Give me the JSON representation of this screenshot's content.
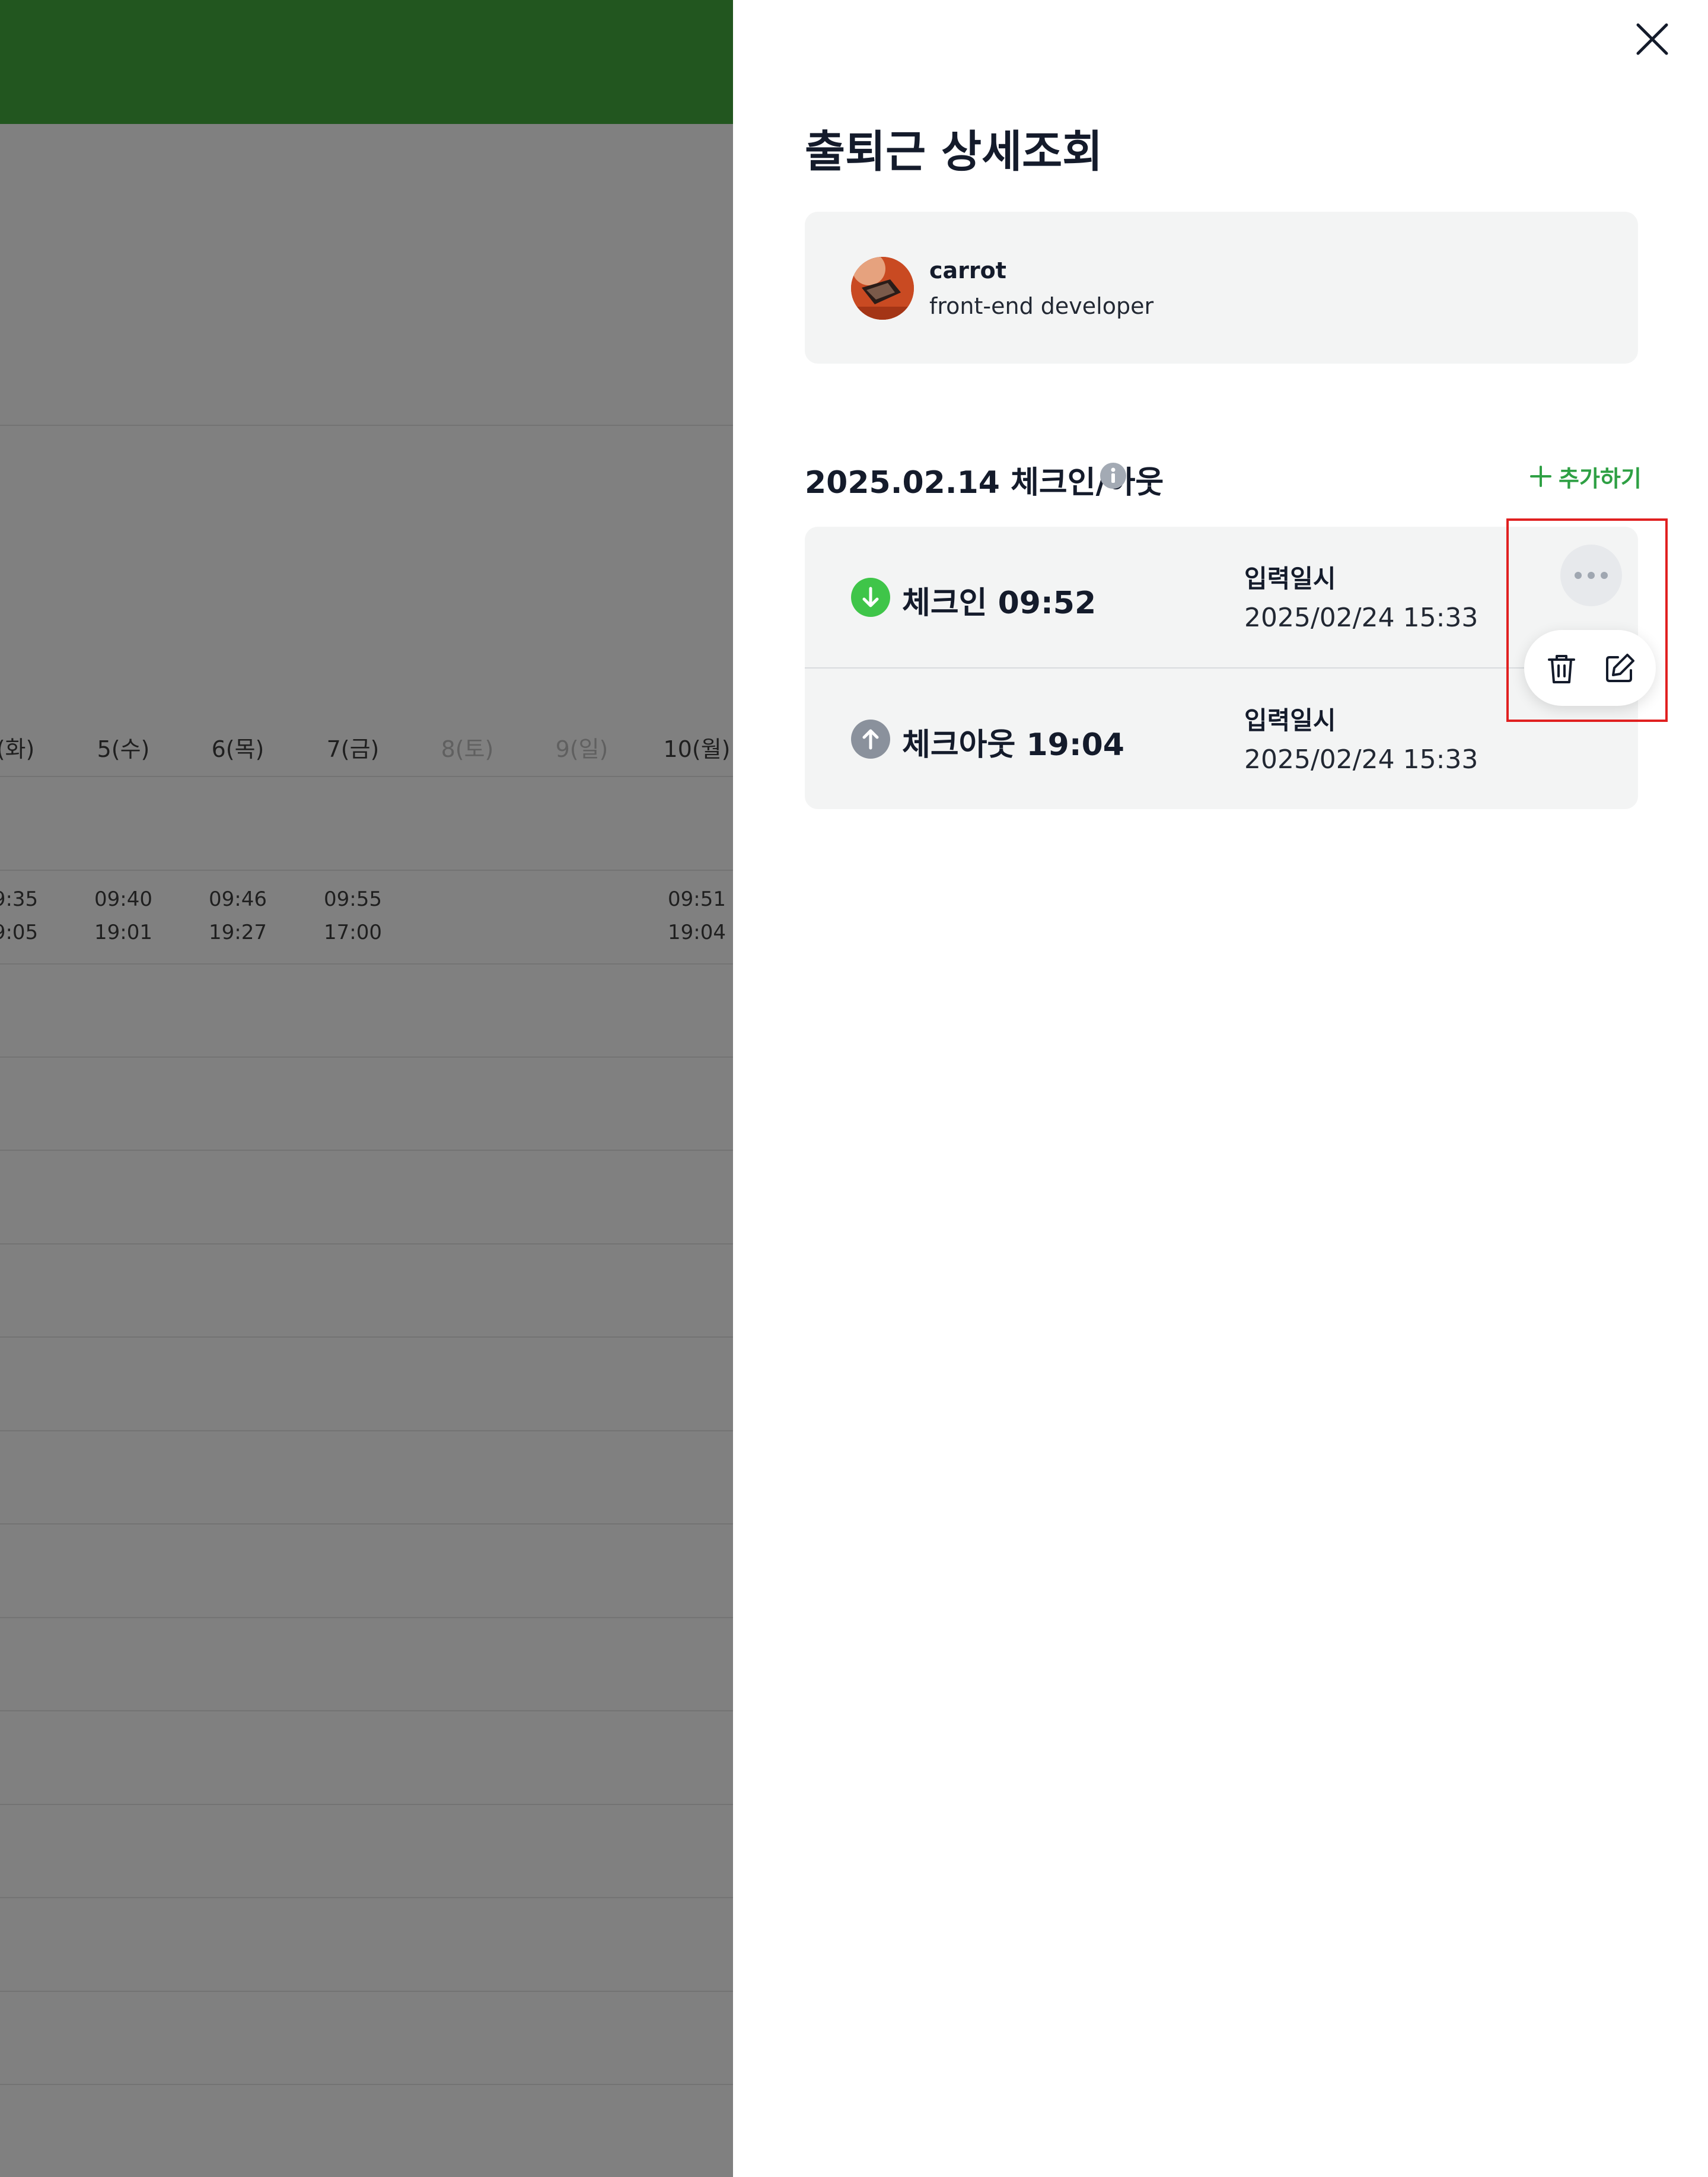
{
  "background": {
    "day_headers": [
      "(화)",
      "5(수)",
      "6(목)",
      "7(금)",
      "8(토)",
      "9(일)",
      "10(월)"
    ],
    "times_in": [
      "9:35",
      "09:40",
      "09:46",
      "09:55",
      "09:51"
    ],
    "times_out": [
      "9:05",
      "19:01",
      "19:27",
      "17:00",
      "19:04"
    ]
  },
  "drawer": {
    "title": "출퇴근 상세조회",
    "close_icon": "close-icon",
    "user": {
      "name": "carrot",
      "role": "front-end developer",
      "avatar": "avatar-photo"
    },
    "section_title": "2025.02.14 체크인/아웃",
    "info_icon": "info-icon",
    "add_label": "추가하기",
    "records": [
      {
        "label": "체크인 09:52",
        "meta_label": "입력일시",
        "meta_value": "2025/02/24 15:33",
        "icon": "arrow-down-icon",
        "icon_color": "#3fc549"
      },
      {
        "label": "체크아웃 19:04",
        "meta_label": "입력일시",
        "meta_value": "2025/02/24 15:33",
        "icon": "arrow-up-icon",
        "icon_color": "#8a919c"
      }
    ],
    "actions": {
      "more_icon": "more-horizontal-icon",
      "delete_icon": "trash-icon",
      "edit_icon": "edit-icon"
    },
    "colors": {
      "accent": "#2ea044",
      "highlight": "#e02020",
      "header_green": "#22561f"
    }
  }
}
